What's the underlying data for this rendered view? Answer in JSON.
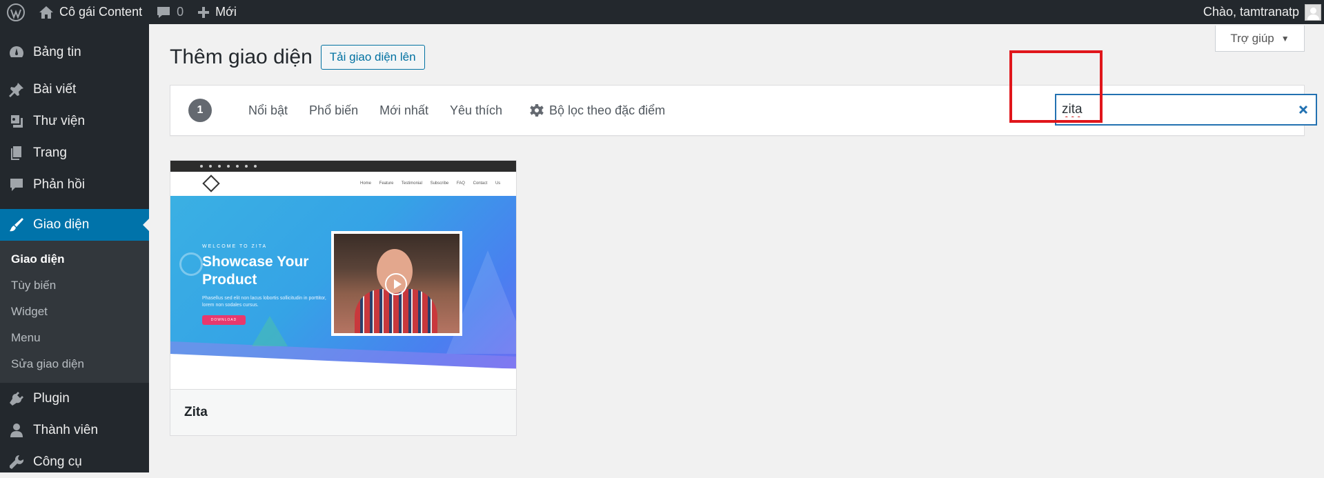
{
  "adminbar": {
    "site_name": "Cô gái Content",
    "comments_count": "0",
    "new_label": "Mới",
    "greeting": "Chào, tamtranatp"
  },
  "sidebar": {
    "items": [
      {
        "label": "Bảng tin",
        "icon": "dashboard-icon"
      },
      {
        "label": "Bài viết",
        "icon": "pin-icon"
      },
      {
        "label": "Thư viện",
        "icon": "media-icon"
      },
      {
        "label": "Trang",
        "icon": "pages-icon"
      },
      {
        "label": "Phản hồi",
        "icon": "comment-icon"
      },
      {
        "label": "Giao diện",
        "icon": "brush-icon",
        "active": true
      },
      {
        "label": "Plugin",
        "icon": "plugin-icon"
      },
      {
        "label": "Thành viên",
        "icon": "user-icon"
      },
      {
        "label": "Công cụ",
        "icon": "wrench-icon"
      }
    ],
    "submenu": [
      "Giao diện",
      "Tùy biến",
      "Widget",
      "Menu",
      "Sửa giao diện"
    ]
  },
  "help_label": "Trợ giúp",
  "page": {
    "title": "Thêm giao diện",
    "upload_label": "Tải giao diện lên"
  },
  "filter": {
    "count": "1",
    "tabs": [
      "Nổi bật",
      "Phổ biến",
      "Mới nhất",
      "Yêu thích"
    ],
    "feature_filter": "Bộ lọc theo đặc điểm",
    "search_value": "zita"
  },
  "theme": {
    "name": "Zita",
    "preview": {
      "menu": "Home Feature Testimonial Subscribe FAQ Contact Us",
      "welcome": "WELCOME TO ZITA",
      "headline": "Showcase Your Product",
      "body": "Phasellus sed elit non lacus lobortis sollicitudin in porttitor, lorem non sodales cursus.",
      "download": "DOWNLOAD"
    }
  },
  "colors": {
    "adminbar": "#23282d",
    "active_menu": "#0073aa",
    "highlight": "#e0161b"
  }
}
